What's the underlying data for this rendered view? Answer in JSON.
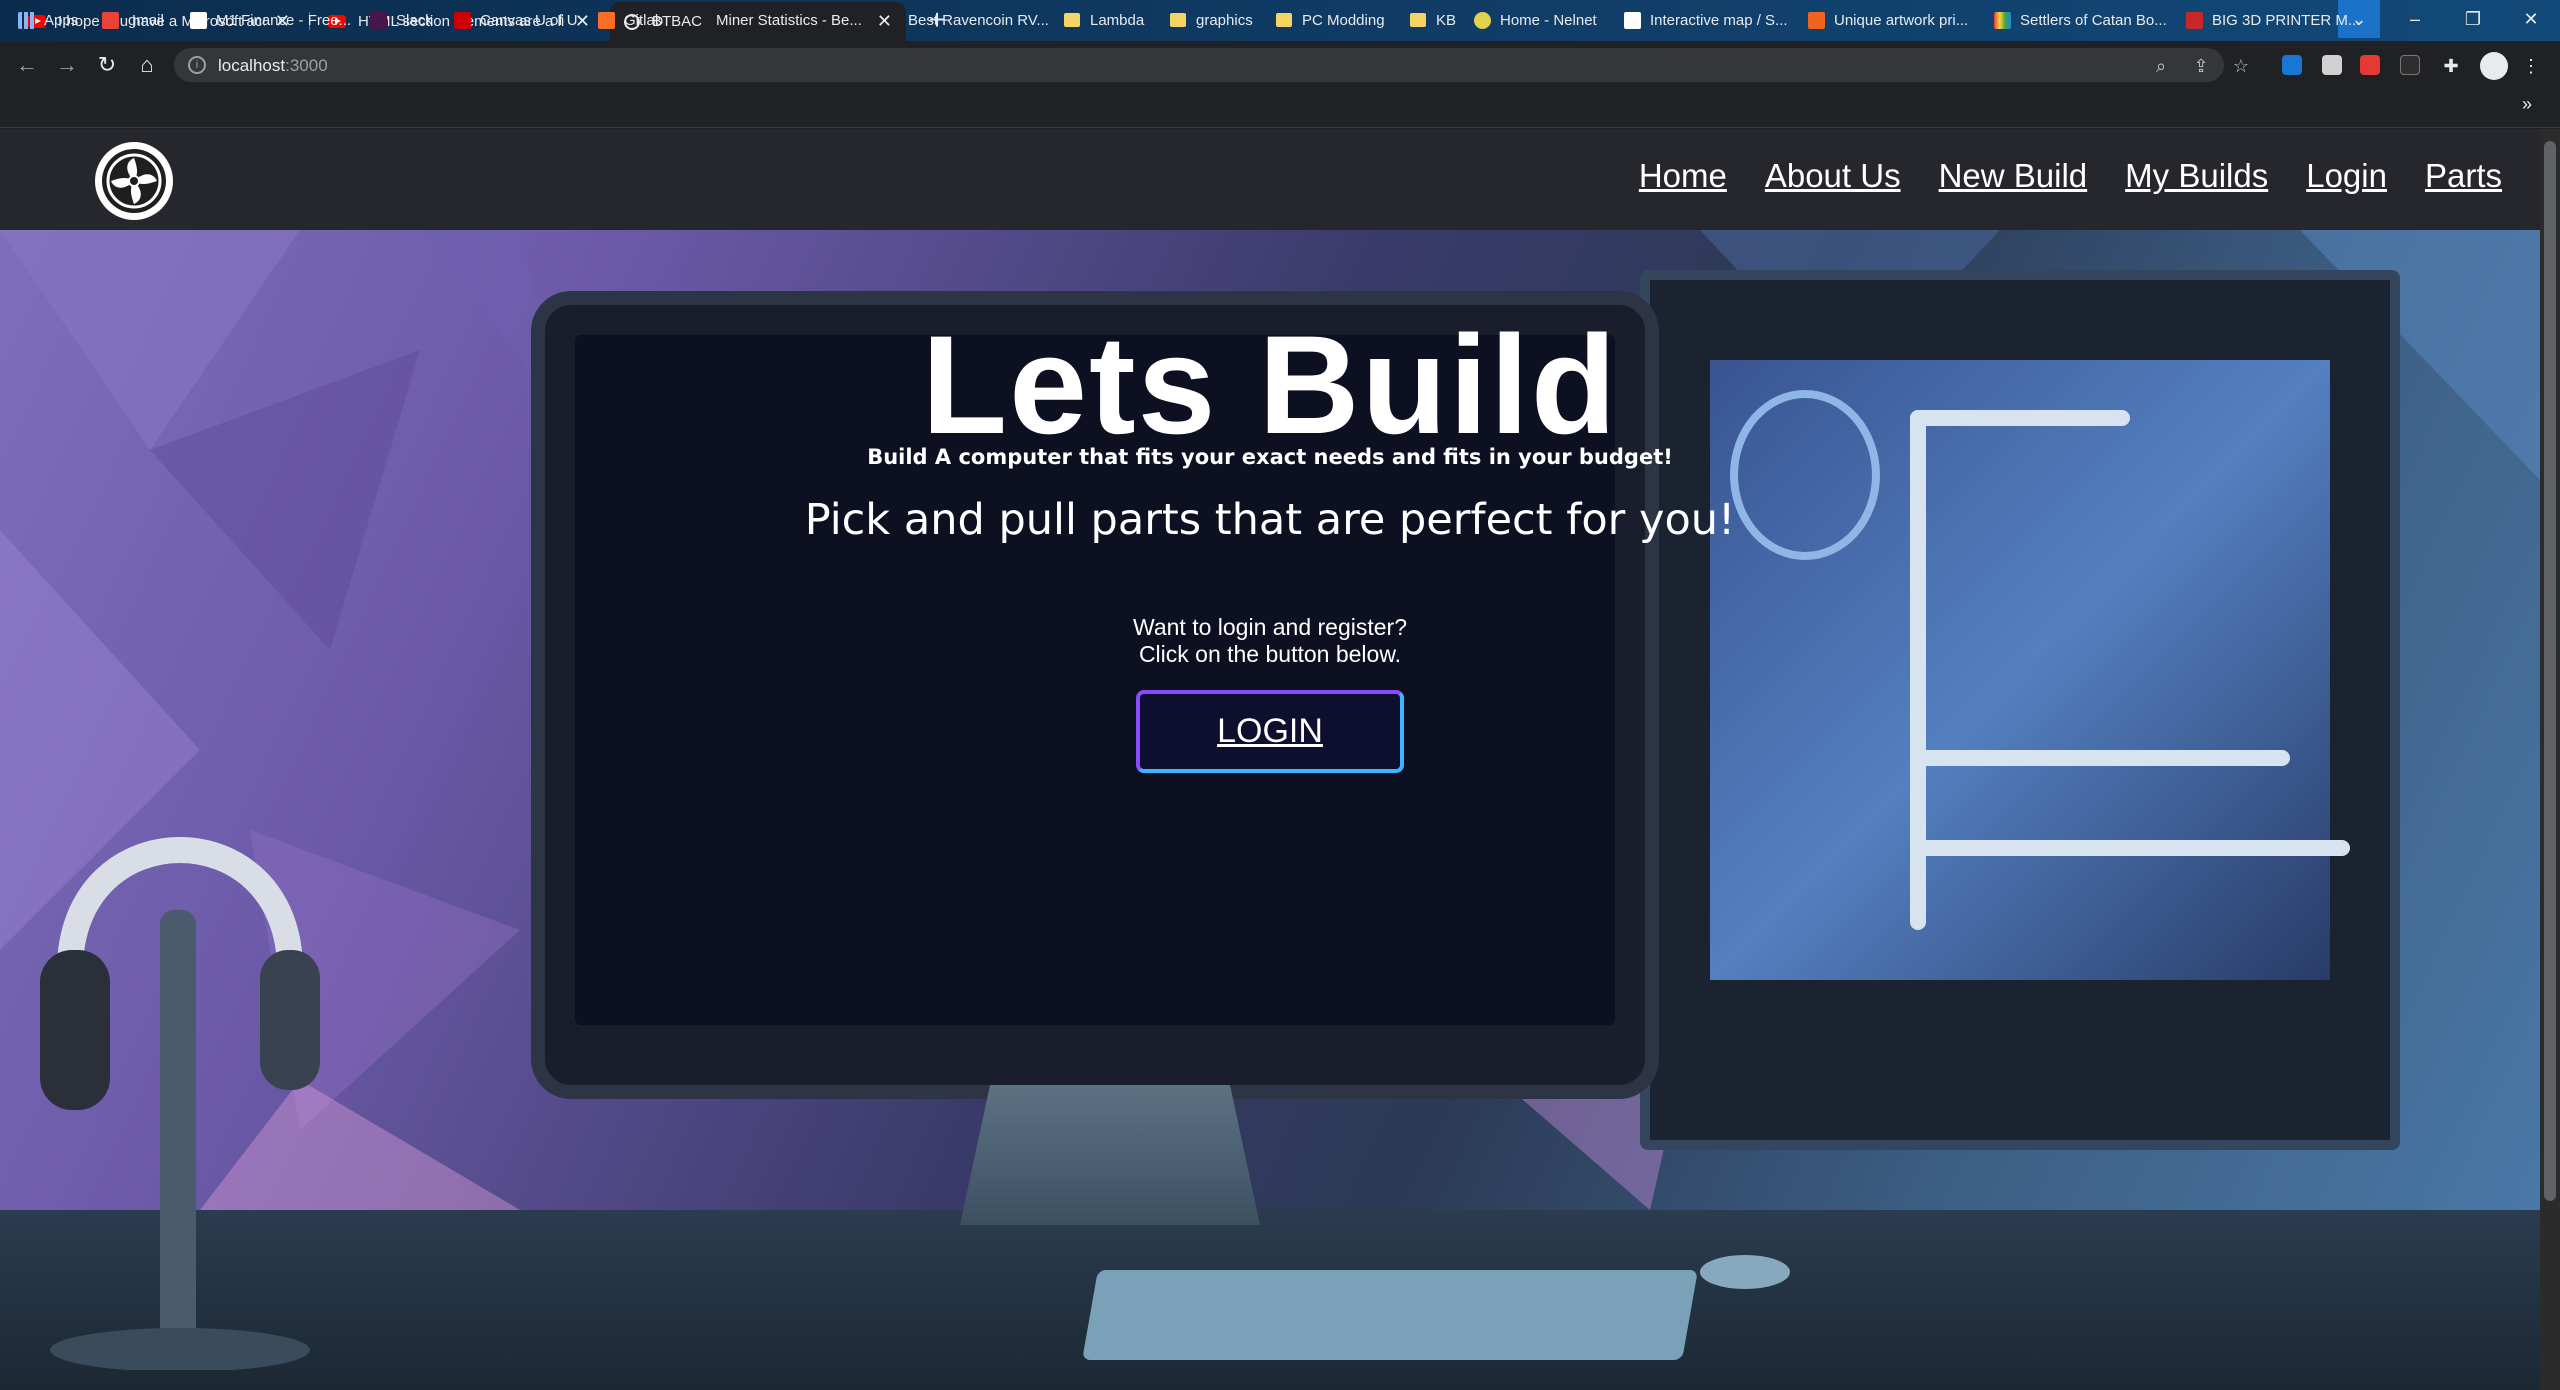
{
  "browser": {
    "tabs": [
      {
        "title": "I hope you have a Microsoft acc",
        "favicon": "youtube-icon",
        "active": false
      },
      {
        "title": "HTML section elements are a lie",
        "favicon": "youtube-icon",
        "active": false
      },
      {
        "title": "BTBAC",
        "favicon": "site-logo-icon",
        "active": true
      }
    ],
    "url_host": "localhost",
    "url_port": ":3000",
    "bookmarks": [
      {
        "label": "Apps",
        "icon": "apps-grid-icon"
      },
      {
        "label": "gmail",
        "icon": "gmail-icon"
      },
      {
        "label": "M1 Finance - Free...",
        "icon": "m1-icon"
      },
      {
        "label": "Slack",
        "icon": "slack-icon"
      },
      {
        "label": "Canvas U of U",
        "icon": "utah-icon"
      },
      {
        "label": "Gitlab",
        "icon": "gitlab-icon"
      },
      {
        "label": "Miner Statistics - Be...",
        "icon": "blank-icon"
      },
      {
        "label": "Best Ravencoin RV...",
        "icon": "blank-icon"
      },
      {
        "label": "Lambda",
        "icon": "folder-icon"
      },
      {
        "label": "graphics",
        "icon": "folder-icon"
      },
      {
        "label": "PC Modding",
        "icon": "folder-icon"
      },
      {
        "label": "KB",
        "icon": "folder-icon"
      },
      {
        "label": "Home - Nelnet",
        "icon": "nelnet-icon"
      },
      {
        "label": "Interactive map / S...",
        "icon": "map-icon"
      },
      {
        "label": "Unique artwork pri...",
        "icon": "etsy-icon"
      },
      {
        "label": "Settlers of Catan Bo...",
        "icon": "catan-icon"
      },
      {
        "label": "BIG 3D PRINTER M...",
        "icon": "printer-icon"
      }
    ]
  },
  "site": {
    "nav": [
      {
        "label": "Home"
      },
      {
        "label": "About Us"
      },
      {
        "label": "New Build"
      },
      {
        "label": "My Builds"
      },
      {
        "label": "Login"
      },
      {
        "label": "Parts"
      }
    ],
    "hero": {
      "title": "Lets Build",
      "subtitle": "Build A computer that fits your exact needs and fits in your budget!",
      "tagline": "Pick and pull parts that are perfect for you!",
      "note_line1": "Want to login and register?",
      "note_line2": "Click on the button below.",
      "button": "LOGIN"
    }
  }
}
